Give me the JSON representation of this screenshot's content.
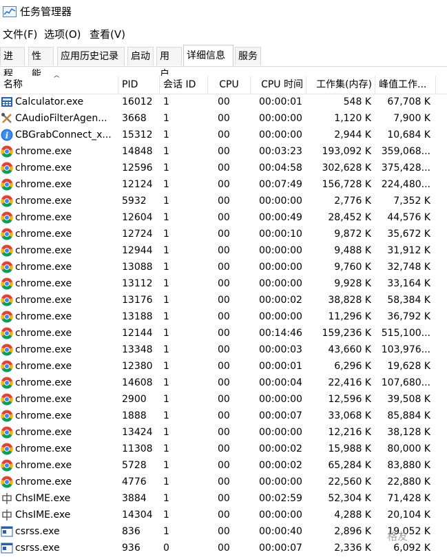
{
  "window": {
    "title": "任务管理器"
  },
  "menu": [
    "文件(F)",
    "选项(O)",
    "查看(V)"
  ],
  "tabs": [
    "进程",
    "性能",
    "应用历史记录",
    "启动",
    "用户",
    "详细信息",
    "服务"
  ],
  "active_tab": "详细信息",
  "columns": [
    "名称",
    "PID",
    "会话 ID",
    "CPU",
    "CPU 时间",
    "工作集(内存)",
    "峰值工作..."
  ],
  "rows": [
    {
      "icon": "calculator",
      "name": "Calculator.exe",
      "pid": "16012",
      "session": "1",
      "cpu": "00",
      "cpu_time": "00:00:01",
      "ws": "548 K",
      "peak": "67,708 K"
    },
    {
      "icon": "tools",
      "name": "CAudioFilterAgen...",
      "pid": "3668",
      "session": "1",
      "cpu": "00",
      "cpu_time": "00:00:00",
      "ws": "1,120 K",
      "peak": "7,900 K"
    },
    {
      "icon": "info",
      "name": "CBGrabConnect_x...",
      "pid": "15312",
      "session": "1",
      "cpu": "00",
      "cpu_time": "00:00:00",
      "ws": "2,944 K",
      "peak": "10,684 K"
    },
    {
      "icon": "chrome",
      "name": "chrome.exe",
      "pid": "14848",
      "session": "1",
      "cpu": "00",
      "cpu_time": "00:03:23",
      "ws": "193,092 K",
      "peak": "359,068..."
    },
    {
      "icon": "chrome",
      "name": "chrome.exe",
      "pid": "12596",
      "session": "1",
      "cpu": "00",
      "cpu_time": "00:04:58",
      "ws": "302,628 K",
      "peak": "375,428..."
    },
    {
      "icon": "chrome",
      "name": "chrome.exe",
      "pid": "12124",
      "session": "1",
      "cpu": "00",
      "cpu_time": "00:07:49",
      "ws": "156,728 K",
      "peak": "224,480..."
    },
    {
      "icon": "chrome",
      "name": "chrome.exe",
      "pid": "5932",
      "session": "1",
      "cpu": "00",
      "cpu_time": "00:00:00",
      "ws": "2,776 K",
      "peak": "7,352 K"
    },
    {
      "icon": "chrome",
      "name": "chrome.exe",
      "pid": "12604",
      "session": "1",
      "cpu": "00",
      "cpu_time": "00:00:49",
      "ws": "28,452 K",
      "peak": "44,576 K"
    },
    {
      "icon": "chrome",
      "name": "chrome.exe",
      "pid": "12724",
      "session": "1",
      "cpu": "00",
      "cpu_time": "00:00:10",
      "ws": "9,872 K",
      "peak": "35,672 K"
    },
    {
      "icon": "chrome",
      "name": "chrome.exe",
      "pid": "12944",
      "session": "1",
      "cpu": "00",
      "cpu_time": "00:00:00",
      "ws": "9,488 K",
      "peak": "31,912 K"
    },
    {
      "icon": "chrome",
      "name": "chrome.exe",
      "pid": "13088",
      "session": "1",
      "cpu": "00",
      "cpu_time": "00:00:00",
      "ws": "9,760 K",
      "peak": "32,748 K"
    },
    {
      "icon": "chrome",
      "name": "chrome.exe",
      "pid": "13112",
      "session": "1",
      "cpu": "00",
      "cpu_time": "00:00:00",
      "ws": "9,928 K",
      "peak": "33,164 K"
    },
    {
      "icon": "chrome",
      "name": "chrome.exe",
      "pid": "13176",
      "session": "1",
      "cpu": "00",
      "cpu_time": "00:00:02",
      "ws": "38,828 K",
      "peak": "58,384 K"
    },
    {
      "icon": "chrome",
      "name": "chrome.exe",
      "pid": "13188",
      "session": "1",
      "cpu": "00",
      "cpu_time": "00:00:00",
      "ws": "11,296 K",
      "peak": "36,792 K"
    },
    {
      "icon": "chrome",
      "name": "chrome.exe",
      "pid": "12144",
      "session": "1",
      "cpu": "00",
      "cpu_time": "00:14:46",
      "ws": "159,236 K",
      "peak": "515,100..."
    },
    {
      "icon": "chrome",
      "name": "chrome.exe",
      "pid": "13348",
      "session": "1",
      "cpu": "00",
      "cpu_time": "00:00:03",
      "ws": "43,660 K",
      "peak": "103,976..."
    },
    {
      "icon": "chrome",
      "name": "chrome.exe",
      "pid": "12380",
      "session": "1",
      "cpu": "00",
      "cpu_time": "00:00:01",
      "ws": "6,296 K",
      "peak": "19,628 K"
    },
    {
      "icon": "chrome",
      "name": "chrome.exe",
      "pid": "14608",
      "session": "1",
      "cpu": "00",
      "cpu_time": "00:00:04",
      "ws": "22,416 K",
      "peak": "107,680..."
    },
    {
      "icon": "chrome",
      "name": "chrome.exe",
      "pid": "2900",
      "session": "1",
      "cpu": "00",
      "cpu_time": "00:00:00",
      "ws": "12,596 K",
      "peak": "39,508 K"
    },
    {
      "icon": "chrome",
      "name": "chrome.exe",
      "pid": "1888",
      "session": "1",
      "cpu": "00",
      "cpu_time": "00:00:07",
      "ws": "33,068 K",
      "peak": "85,884 K"
    },
    {
      "icon": "chrome",
      "name": "chrome.exe",
      "pid": "13424",
      "session": "1",
      "cpu": "00",
      "cpu_time": "00:00:00",
      "ws": "12,216 K",
      "peak": "38,128 K"
    },
    {
      "icon": "chrome",
      "name": "chrome.exe",
      "pid": "11308",
      "session": "1",
      "cpu": "00",
      "cpu_time": "00:00:02",
      "ws": "15,988 K",
      "peak": "80,000 K"
    },
    {
      "icon": "chrome",
      "name": "chrome.exe",
      "pid": "5728",
      "session": "1",
      "cpu": "00",
      "cpu_time": "00:00:02",
      "ws": "65,284 K",
      "peak": "83,880 K"
    },
    {
      "icon": "chrome",
      "name": "chrome.exe",
      "pid": "4776",
      "session": "1",
      "cpu": "00",
      "cpu_time": "00:00:00",
      "ws": "22,560 K",
      "peak": "22,880 K"
    },
    {
      "icon": "ime",
      "name": "ChsIME.exe",
      "pid": "3884",
      "session": "1",
      "cpu": "00",
      "cpu_time": "00:02:59",
      "ws": "52,304 K",
      "peak": "71,428 K"
    },
    {
      "icon": "ime",
      "name": "ChsIME.exe",
      "pid": "14304",
      "session": "1",
      "cpu": "00",
      "cpu_time": "00:00:00",
      "ws": "4,288 K",
      "peak": "20,104 K"
    },
    {
      "icon": "window",
      "name": "csrss.exe",
      "pid": "836",
      "session": "1",
      "cpu": "00",
      "cpu_time": "00:00:40",
      "ws": "2,896 K",
      "peak": "19,052 K"
    },
    {
      "icon": "window",
      "name": "csrss.exe",
      "pid": "936",
      "session": "0",
      "cpu": "00",
      "cpu_time": "00:00:07",
      "ws": "2,336 K",
      "peak": "6,092 K"
    }
  ],
  "watermark": "格友"
}
